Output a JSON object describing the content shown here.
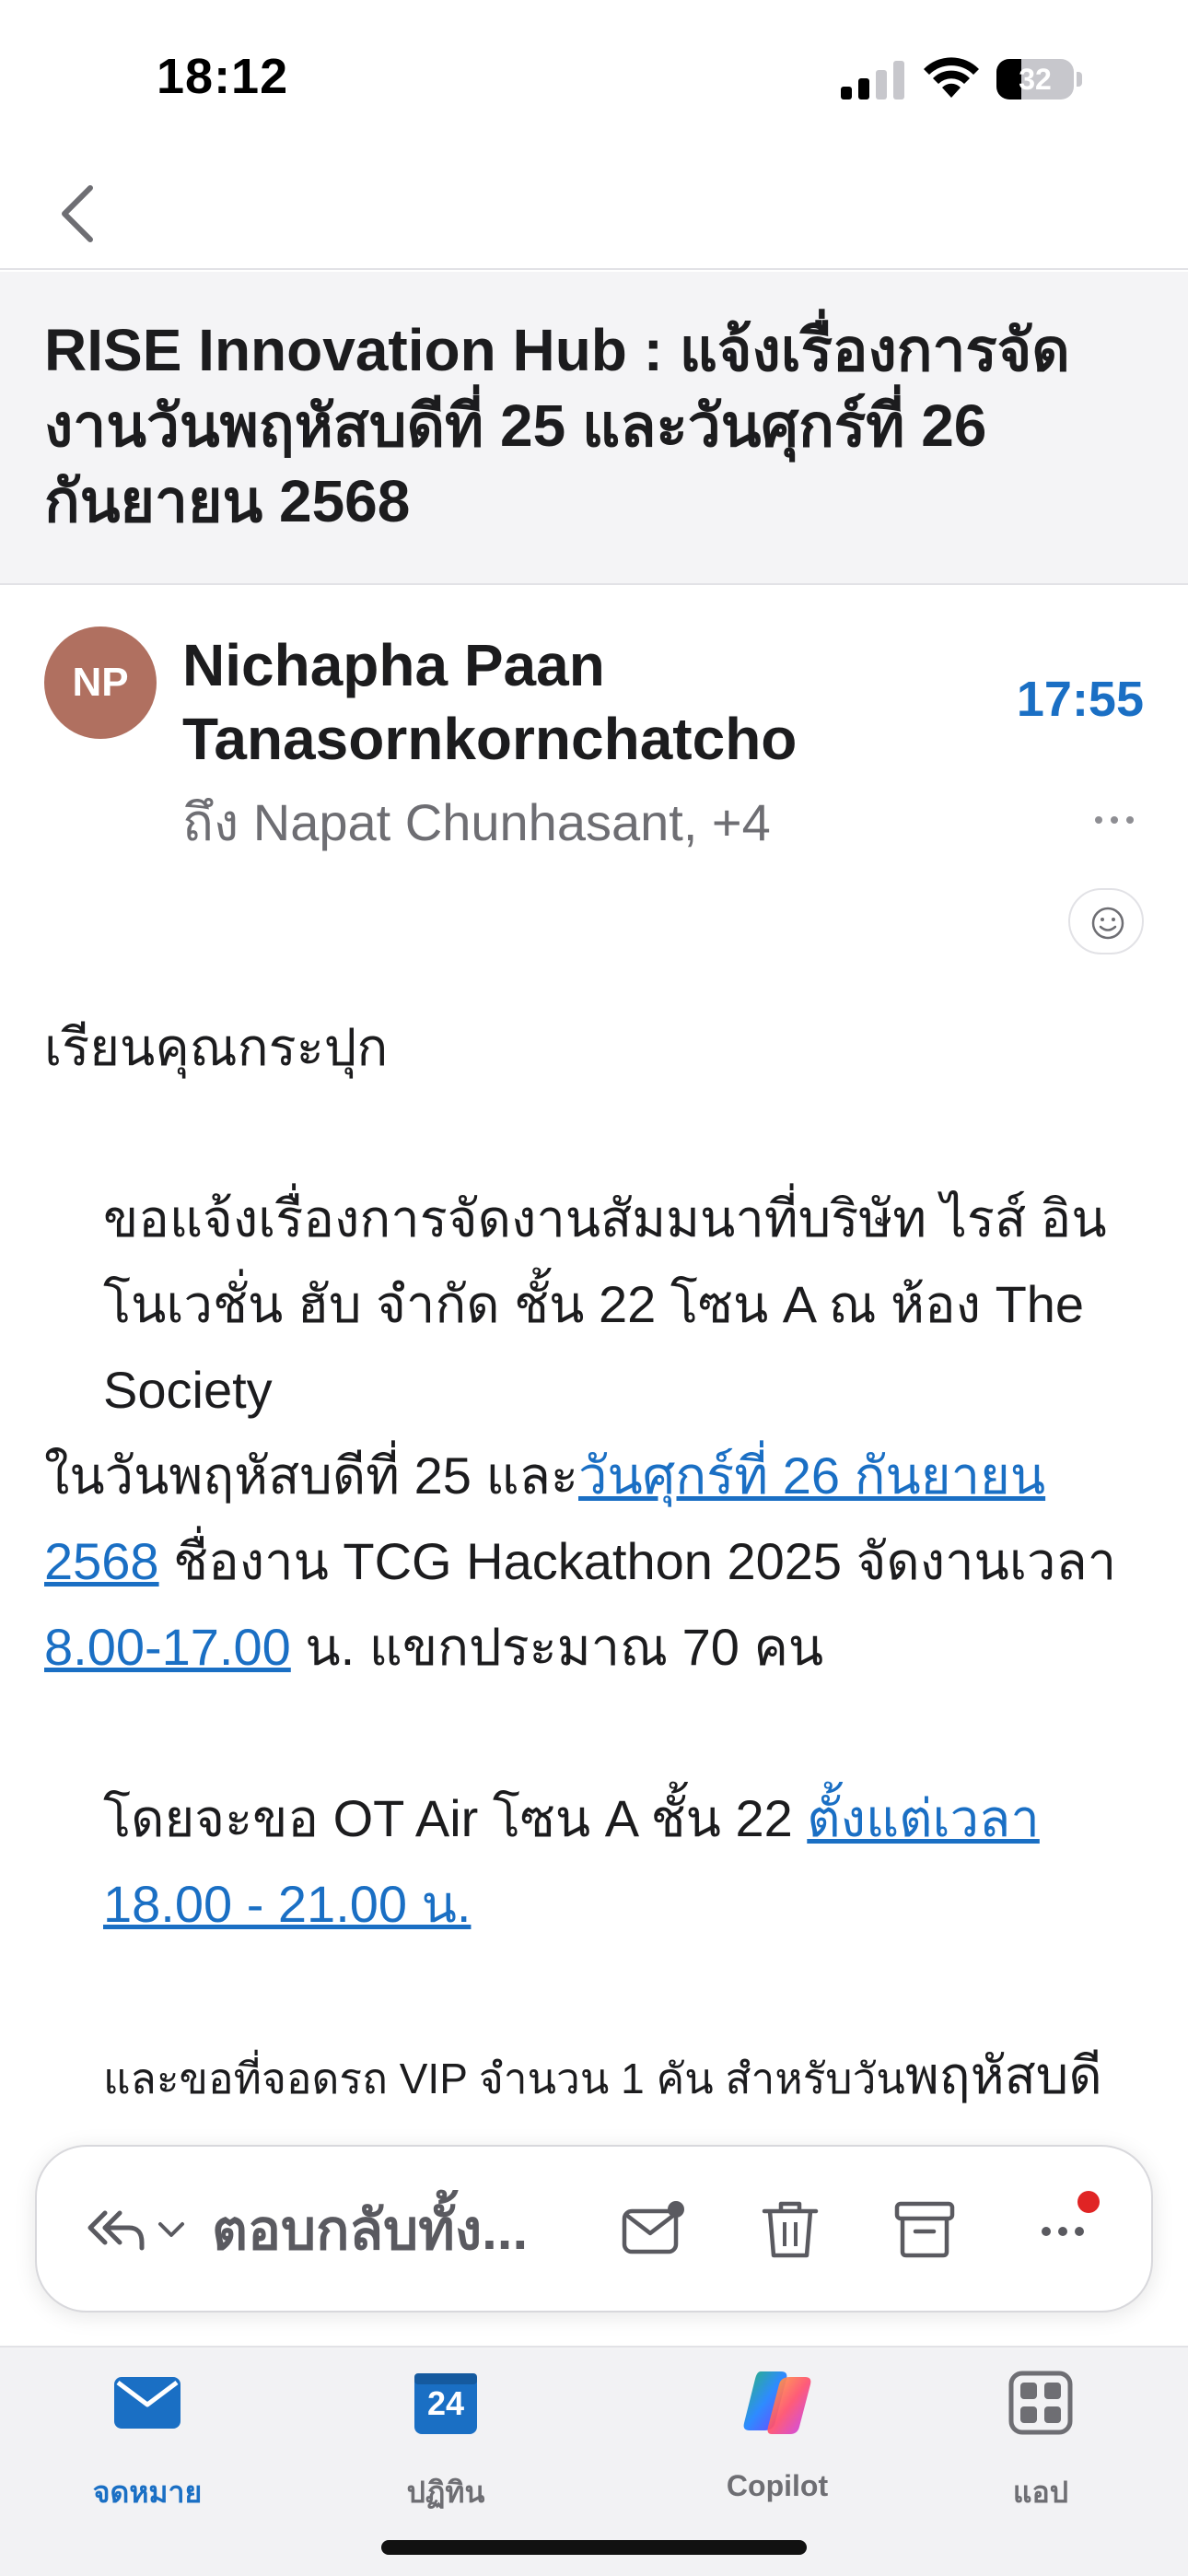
{
  "status": {
    "time": "18:12",
    "battery": "32",
    "battery_level": 0.32
  },
  "nav": {
    "back_icon": "chevron-left-icon"
  },
  "email": {
    "subject": "RISE Innovation Hub : แจ้งเรื่องการจัดงานวันพฤหัสบดีที่ 25 และวันศุกร์ที่ 26 กันยายน 2568",
    "avatar_initials": "NP",
    "avatar_color": "#b07060",
    "sender_name": "Nichapha Paan Tanasornkornchatcho",
    "recipients": "ถึง Napat Chunhasant, +4",
    "time": "17:55",
    "body": {
      "greeting": "เรียนคุณกระปุก",
      "p1_a": "ขอแจ้งเรื่องการจัดงานสัมมนาที่บริษัท ไรส์ อินโนเวชั่น ฮับ จำกัด ชั้น 22  โซน A ณ ห้อง The Society",
      "p1_b": "ในวันพฤหัสบดีที่ 25 และ",
      "p1_link1": "วันศุกร์ที่ 26 กันยายน 2568",
      "p1_c": " ชื่องาน TCG Hackathon 2025  จัดงานเวลา  ",
      "p1_link2": "8.00-17.00",
      "p1_d": " น. แขกประมาณ 70 คน",
      "p2_a": "โดยจะขอ OT Air โซน A ชั้น 22 ",
      "p2_link": "ตั้งแต่เวลา 18.00 - 21.00 น.",
      "p3_small": "และขอที่จอดรถ VIP จำนวน 1 คัน สำหรับวัน",
      "p3_large": "พฤหัสบดี"
    }
  },
  "actions": {
    "reply_label": "ตอบกลับทั้ง..."
  },
  "tabs": [
    {
      "label": "จดหมาย",
      "active": true
    },
    {
      "label": "ปฏิทิน",
      "calendar_day": "24"
    },
    {
      "label": "Copilot"
    },
    {
      "label": "แอป"
    }
  ],
  "colors": {
    "accent": "#1a6fc4",
    "notification": "#e02424"
  }
}
